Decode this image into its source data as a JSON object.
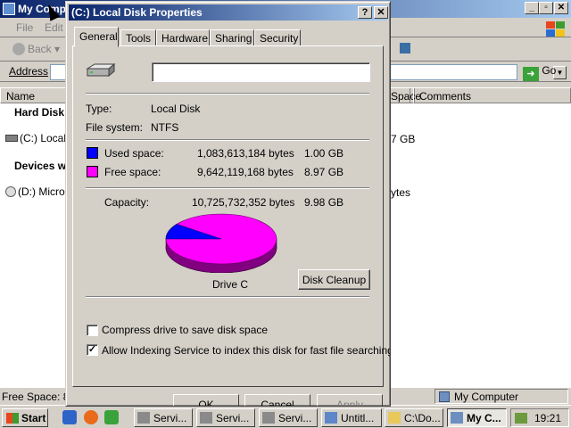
{
  "explorer": {
    "title": "My Comp",
    "menu": [
      "File",
      "Edit"
    ],
    "back_label": "Back",
    "address_label": "Address",
    "go_label": "Go",
    "columns": [
      "Name",
      "Space",
      "Comments"
    ],
    "groups": {
      "hard_disk": "Hard Disk",
      "devices": "Devices w"
    },
    "rows": [
      {
        "name": "(C:) Local",
        "space": "7 GB"
      },
      {
        "name": "(D:) Micro",
        "space": "ytes"
      }
    ],
    "status_left": "Free Space: 8.",
    "status_right": "My Computer"
  },
  "taskbar": {
    "start_label": "Start",
    "tasks": [
      "Servi...",
      "Servi...",
      "Servi...",
      "Untitl...",
      "C:\\Do...",
      "My C..."
    ],
    "active_task_index": 5,
    "clock": "19:21"
  },
  "dialog": {
    "title": "(C:) Local Disk Properties",
    "help_btn": "?",
    "close_btn": "✕",
    "tabs": [
      "General",
      "Tools",
      "Hardware",
      "Sharing",
      "Security"
    ],
    "selected_tab": "General",
    "volume_label_value": "",
    "type_label": "Type:",
    "type_value": "Local Disk",
    "fs_label": "File system:",
    "fs_value": "NTFS",
    "used_label": "Used space:",
    "used_bytes": "1,083,613,184 bytes",
    "used_gb": "1.00 GB",
    "free_label": "Free space:",
    "free_bytes": "9,642,119,168 bytes",
    "free_gb": "8.97 GB",
    "capacity_label": "Capacity:",
    "capacity_bytes": "10,725,732,352 bytes",
    "capacity_gb": "9.98 GB",
    "drive_label": "Drive C",
    "cleanup_label": "Disk Cleanup",
    "compress_label": "Compress drive to save disk space",
    "compress_checked": false,
    "index_label": "Allow Indexing Service to index this disk for fast file searching",
    "index_checked": true,
    "ok_label": "OK",
    "cancel_label": "Cancel",
    "apply_label": "Apply",
    "used_color": "#0000ff",
    "free_color": "#ff00ff"
  }
}
